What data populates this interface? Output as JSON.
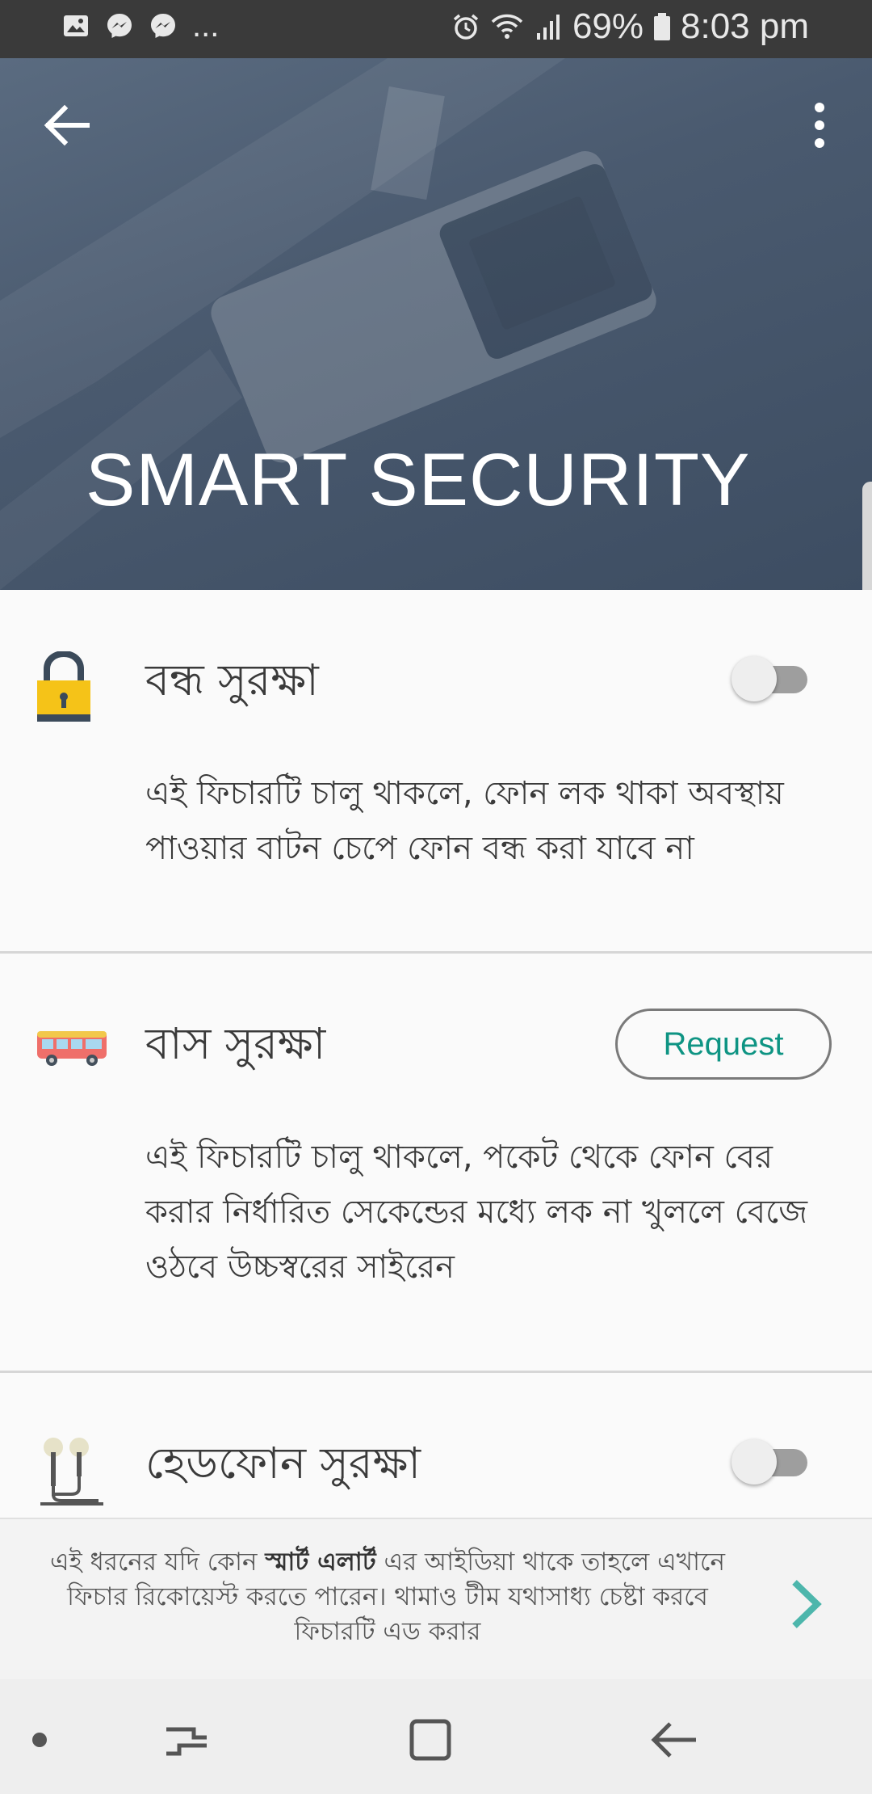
{
  "status_bar": {
    "overflow_dots": "...",
    "battery": "69%",
    "time": "8:03 pm"
  },
  "header": {
    "title": "SMART SECURITY"
  },
  "features": [
    {
      "title": "বন্ধ সুরক্ষা",
      "description": "এই ফিচারটি চালু থাকলে, ফোন লক থাকা অবস্থায় পাওয়ার বাটন চেপে ফোন বন্ধ করা যাবে না",
      "control": "toggle",
      "enabled": false,
      "icon": "padlock-icon"
    },
    {
      "title": "বাস সুরক্ষা",
      "description": "এই ফিচারটি চালু থাকলে, পকেট থেকে ফোন বের করার নির্ধারিত সেকেন্ডের মধ্যে লক না খুললে বেজে ওঠবে উচ্চস্বরের সাইরেন",
      "control": "button",
      "button_label": "Request",
      "icon": "bus-icon"
    },
    {
      "title": "হেডফোন সুরক্ষা",
      "control": "toggle",
      "enabled": false,
      "icon": "earphones-icon"
    }
  ],
  "banner": {
    "text_before": "এই ধরনের যদি কোন ",
    "text_bold": "স্মার্ট এলার্ট",
    "text_after": " এর আইডিয়া থাকে তাহলে এখানে ফিচার রিকোয়েস্ট করতে পারেন। থামাও টীম যথাসাধ্য চেষ্টা করবে ফিচারটি এড করার"
  },
  "colors": {
    "header_bg": "#4a5a6f",
    "accent_teal": "#0e9483",
    "status_bar_bg": "#3a3a3a"
  }
}
